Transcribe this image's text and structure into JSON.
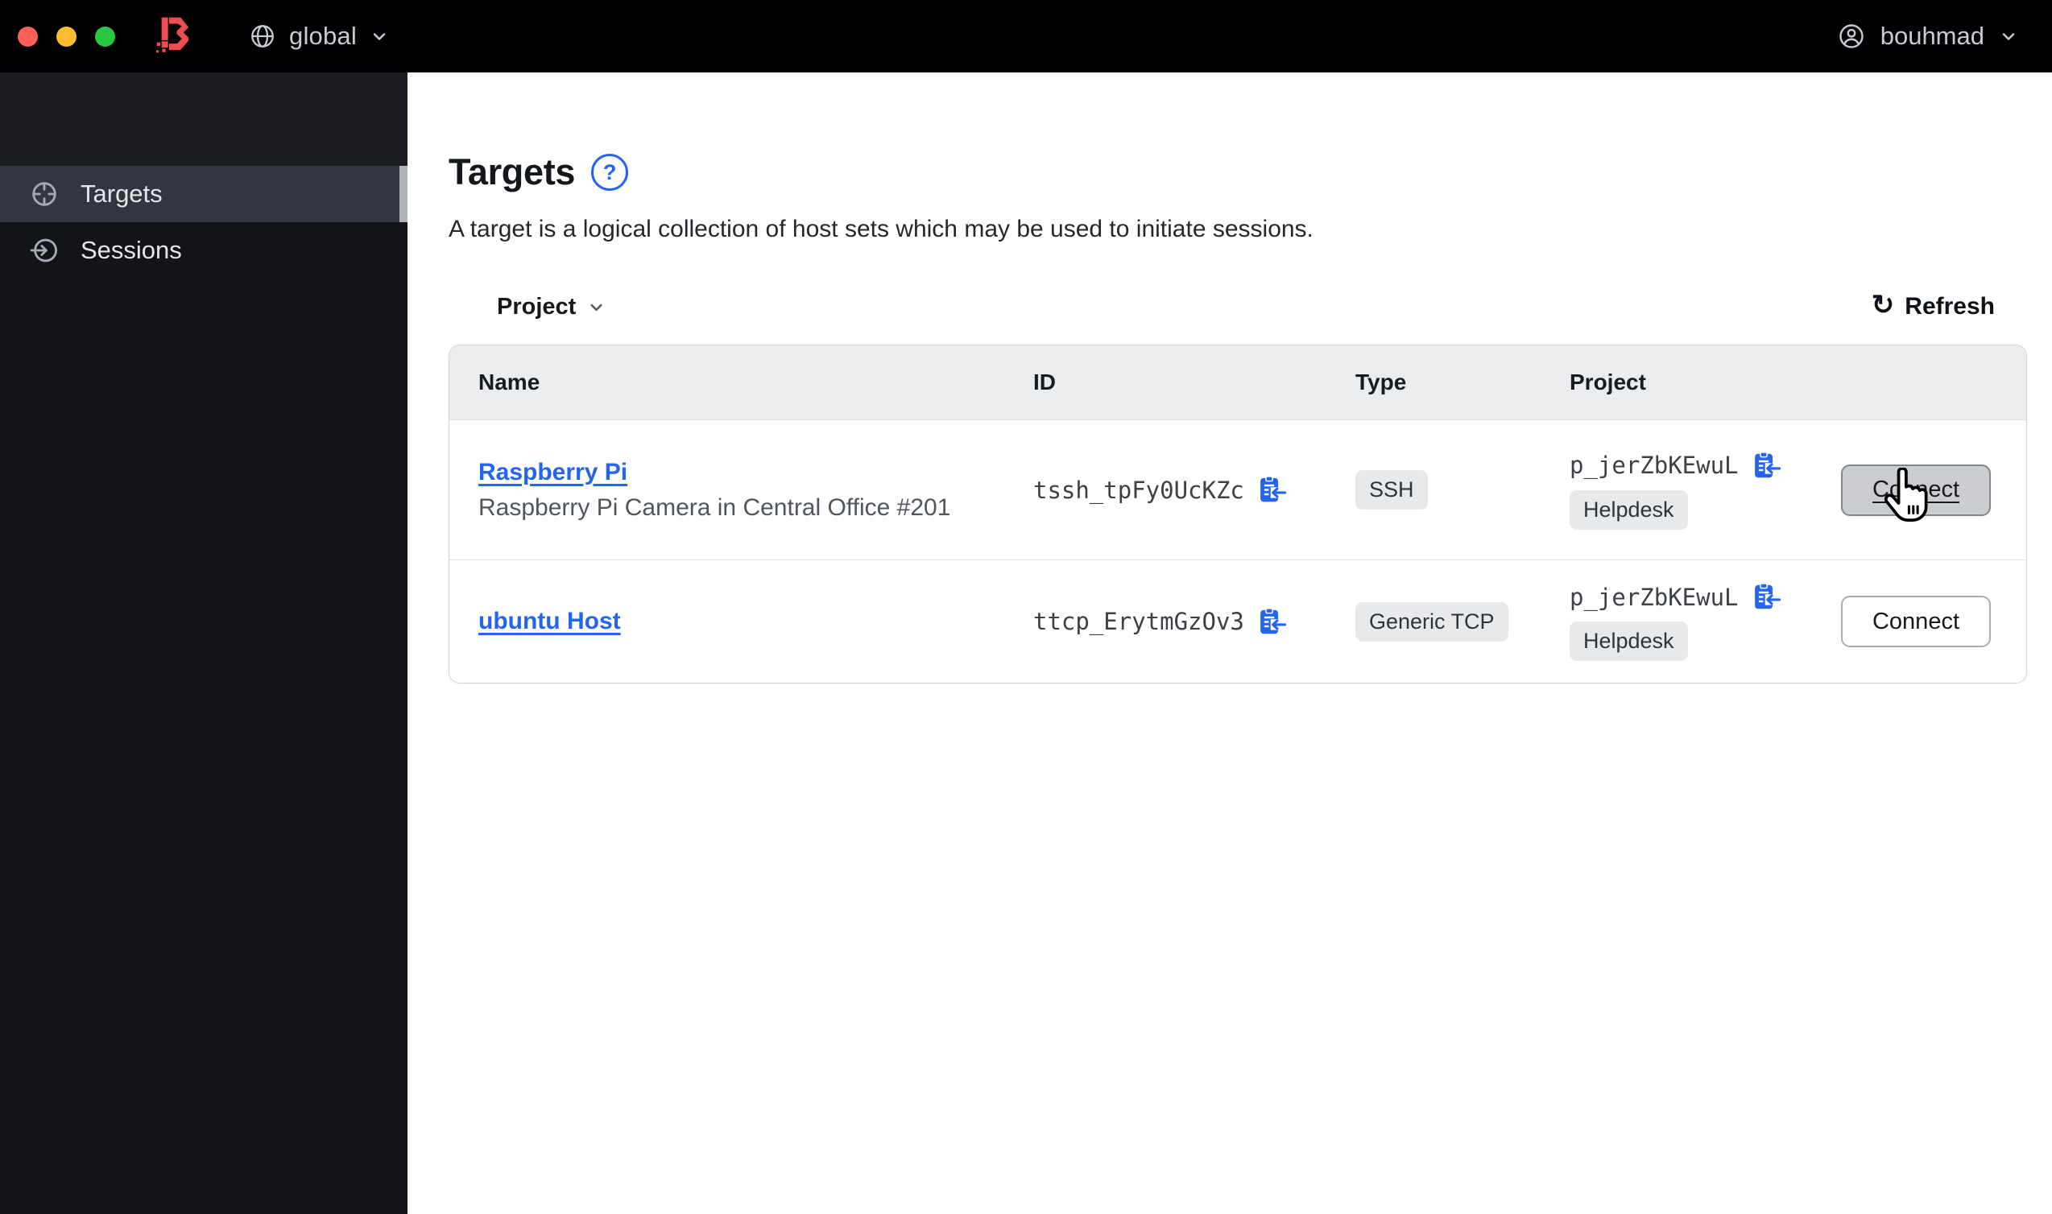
{
  "window": {
    "traffic_lights": [
      {
        "name": "close",
        "color": "#ff5f57"
      },
      {
        "name": "minimize",
        "color": "#febc2e"
      },
      {
        "name": "zoom",
        "color": "#28c840"
      }
    ]
  },
  "topbar": {
    "scope_label": "global",
    "user_label": "bouhmad"
  },
  "sidebar": {
    "items": [
      {
        "label": "Targets",
        "icon": "target-icon",
        "active": true
      },
      {
        "label": "Sessions",
        "icon": "session-icon",
        "active": false
      }
    ]
  },
  "main": {
    "title": "Targets",
    "help_glyph": "?",
    "description": "A target is a logical collection of host sets which may be used to initiate sessions.",
    "filter_label": "Project",
    "refresh_label": "Refresh",
    "refresh_icon_glyph": "↻",
    "table": {
      "columns": [
        "Name",
        "ID",
        "Type",
        "Project"
      ],
      "rows": [
        {
          "name": "Raspberry Pi",
          "description": "Raspberry Pi Camera in Central Office #201",
          "id": "tssh_tpFy0UcKZc",
          "type": "SSH",
          "project_id": "p_jerZbKEwuL",
          "project_name": "Helpdesk",
          "action_label": "Connect",
          "state": "hovered"
        },
        {
          "name": "ubuntu Host",
          "id": "ttcp_ErytmGzOv3",
          "type": "Generic TCP",
          "project_id": "p_jerZbKEwuL",
          "project_name": "Helpdesk",
          "action_label": "Connect",
          "state": "default"
        }
      ]
    }
  },
  "colors": {
    "accent_blue": "#2364f0",
    "brand_red": "#ee4b53",
    "titlebar_bg": "#000000",
    "sidebar_bg": "#131419",
    "sidebar_active_bg": "#32363d",
    "sidebar_active_indicator": "#b0b4ba",
    "badge_bg": "#e8e9ea",
    "table_header_bg": "#ebecee",
    "link_blue": "#2364f0"
  },
  "icons": {
    "boundary-logo": "angular red B mark",
    "globe-icon": "globe with meridians",
    "user-icon": "person inside circle",
    "chevron-down-icon": "⌄",
    "target-icon": "crosshair circle",
    "session-icon": "arrow entering circle",
    "help-icon": "? in circle",
    "refresh-icon": "↻",
    "copy-icon": "clipboard with inbound arrow",
    "mouse-cursor": "hand pointer"
  }
}
